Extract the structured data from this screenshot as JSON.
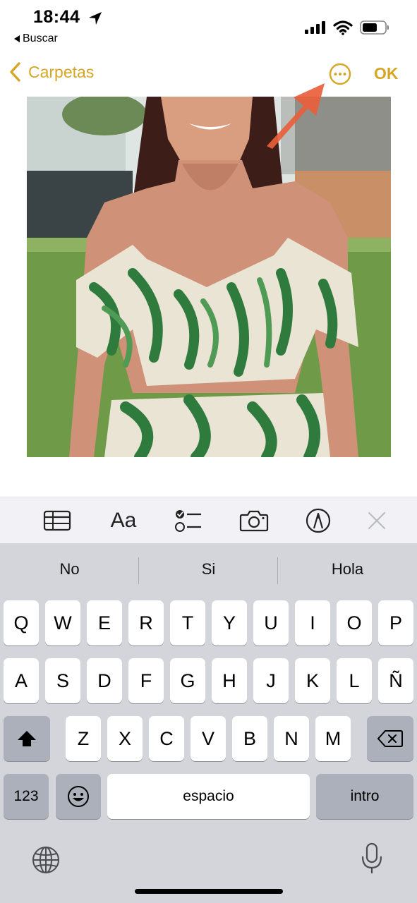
{
  "status_bar": {
    "time": "18:44",
    "back_app_label": "Buscar"
  },
  "nav": {
    "back_label": "Carpetas",
    "ok_label": "OK",
    "accent_color": "#d6a625"
  },
  "toolbar": {
    "format_label": "Aa",
    "icons": [
      "table-icon",
      "format-icon",
      "checklist-icon",
      "camera-icon",
      "markup-icon",
      "close-icon"
    ]
  },
  "keyboard": {
    "suggestions": [
      "No",
      "Si",
      "Hola"
    ],
    "row1": [
      "Q",
      "W",
      "E",
      "R",
      "T",
      "Y",
      "U",
      "I",
      "O",
      "P"
    ],
    "row2": [
      "A",
      "S",
      "D",
      "F",
      "G",
      "H",
      "J",
      "K",
      "L",
      "Ñ"
    ],
    "row3": [
      "Z",
      "X",
      "C",
      "V",
      "B",
      "N",
      "M"
    ],
    "numbers_label": "123",
    "space_label": "espacio",
    "return_label": "intro"
  },
  "annotation_arrow_color": "#e8603c"
}
